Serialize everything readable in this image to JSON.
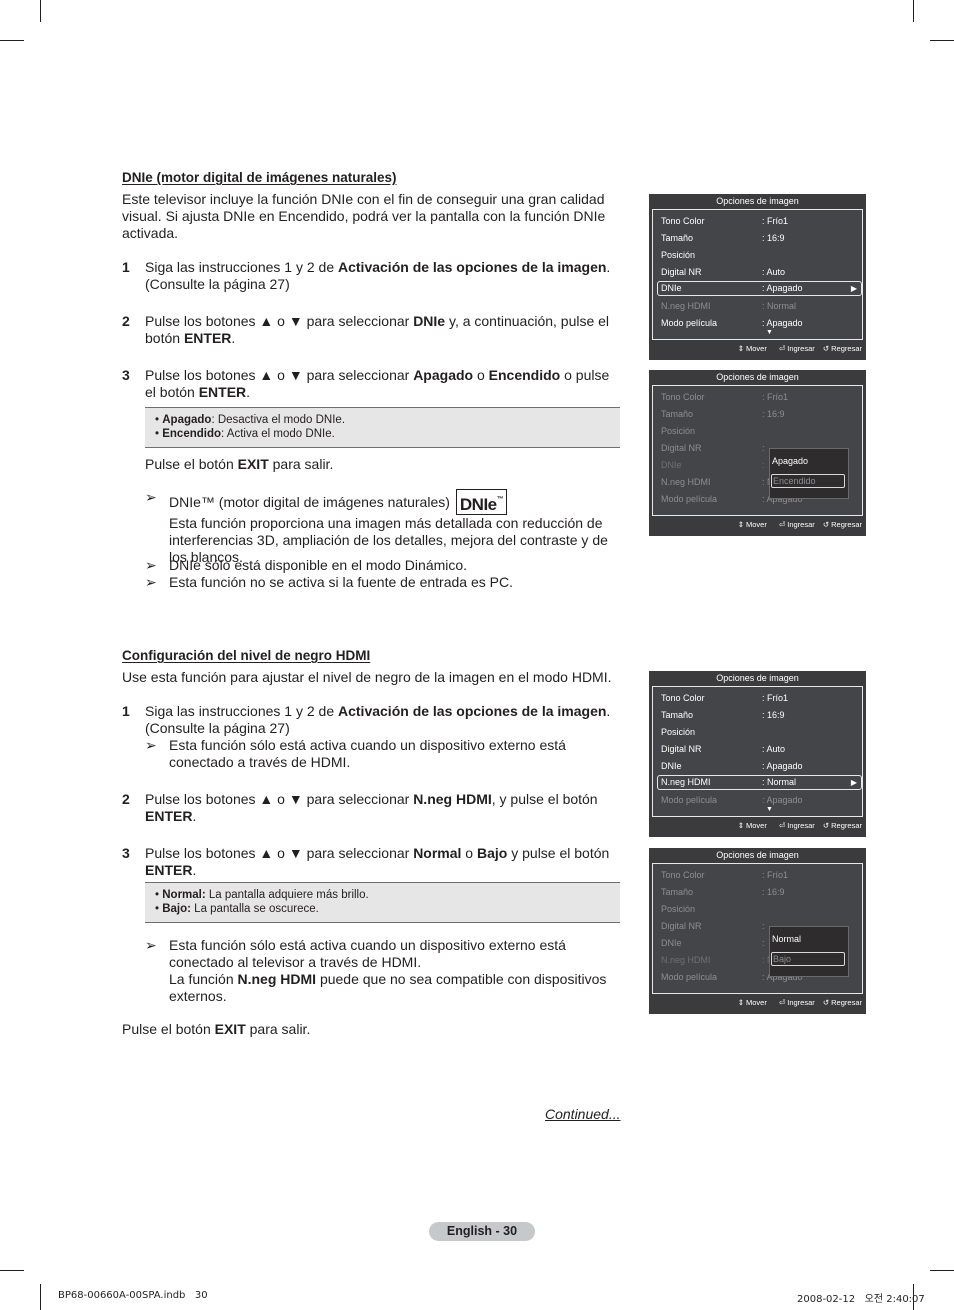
{
  "section1": {
    "title": "DNIe (motor digital de imágenes naturales)",
    "intro": "Este televisor incluye la función DNIe con el fin de conseguir una gran calidad visual. Si ajusta DNIe en Encendido, podrá ver la pantalla con la función DNIe activada.",
    "steps": [
      {
        "num": "1",
        "pre": "Siga las instrucciones 1 y 2 de ",
        "bold": "Activación de las opciones de la imagen",
        "post": ". (Consulte la página 27)"
      },
      {
        "num": "2",
        "pre": "Pulse los botones ▲ o ▼ para seleccionar ",
        "bold": "DNIe",
        "mid": " y, a continuación, pulse el botón ",
        "bold2": "ENTER",
        "post": "."
      },
      {
        "num": "3",
        "pre": "Pulse los botones ▲ o ▼ para seleccionar ",
        "bold": "Apagado",
        "mid": " o ",
        "bold2": "Encendido",
        "mid2": " o pulse el botón ",
        "bold3": "ENTER",
        "post": "."
      }
    ],
    "box": [
      {
        "term": "Apagado",
        "desc": ": Desactiva el modo DNIe."
      },
      {
        "term": "Encendido",
        "desc": ": Activa el modo DNIe."
      }
    ],
    "exit": {
      "pre": "Pulse el botón ",
      "bold": "EXIT",
      "post": " para salir."
    },
    "notes": [
      {
        "text": "DNIe™ (motor digital de imágenes naturales)",
        "logo": "DNIe",
        "logo_tm": "™",
        "text2": "Esta función proporciona una imagen más detallada con reducción de interferencias 3D, ampliación de los detalles, mejora del contraste y de los blancos."
      },
      {
        "text": "DNIe sólo está disponible en el modo Dinámico."
      },
      {
        "text": "Esta función no se activa si la fuente de entrada es PC."
      }
    ]
  },
  "section2": {
    "title": "Configuración del nivel de negro HDMI",
    "intro": "Use esta función para ajustar el nivel de negro de la imagen en el modo HDMI.",
    "steps": [
      {
        "num": "1",
        "pre": "Siga las instrucciones 1 y 2 de ",
        "bold": "Activación de las opciones de la imagen",
        "post": ". (Consulte la página 27)",
        "note": "Esta función sólo está activa cuando un dispositivo externo está conectado a través de HDMI."
      },
      {
        "num": "2",
        "pre": "Pulse los botones ▲ o ▼ para seleccionar ",
        "bold": "N.neg HDMI",
        "mid": ", y pulse el botón ",
        "bold2": "ENTER",
        "post": "."
      },
      {
        "num": "3",
        "pre": "Pulse los botones ▲ o ▼ para seleccionar ",
        "bold": "Normal",
        "mid": " o ",
        "bold2": "Bajo",
        "mid2": " y pulse el botón ",
        "bold3": "ENTER",
        "post": "."
      }
    ],
    "box": [
      {
        "term": "Normal:",
        "desc": " La pantalla adquiere más brillo."
      },
      {
        "term": "Bajo:",
        "desc": " La pantalla se oscurece."
      }
    ],
    "note": {
      "line1": "Esta función sólo está activa cuando un dispositivo externo está conectado al televisor a través de HDMI.",
      "pre": "La función ",
      "bold": "N.neg HDMI",
      "post": " puede que no sea compatible con dispositivos externos."
    },
    "exit": {
      "pre": "Pulse el botón ",
      "bold": "EXIT",
      "post": " para salir."
    }
  },
  "osd_common": {
    "title": "Opciones de imagen",
    "footer": {
      "move_icon": "⇕",
      "move": "Mover",
      "enter_icon": "⏎",
      "enter": "Ingresar",
      "return_icon": "↺",
      "return": "Regresar"
    },
    "arrow_right": "▶",
    "arrow_down": "▼"
  },
  "osd_menus": [
    {
      "rows": [
        {
          "label": "Tono Color",
          "value": ": Frío1"
        },
        {
          "label": "Tamaño",
          "value": ": 16:9"
        },
        {
          "label": "Posición",
          "value": ""
        },
        {
          "label": "Digital NR",
          "value": ": Auto"
        },
        {
          "label": "DNIe",
          "value": ": Apagado"
        },
        {
          "label": "N.neg HDMI",
          "value": ": Normal"
        },
        {
          "label": "Modo película",
          "value": ": Apagado"
        }
      ]
    },
    {
      "rows": [
        {
          "label": "Tono Color",
          "value": ": Frío1"
        },
        {
          "label": "Tamaño",
          "value": ": 16:9"
        },
        {
          "label": "Posición",
          "value": ""
        },
        {
          "label": "Digital NR",
          "value": ":"
        },
        {
          "label": "DNIe",
          "value": ":"
        },
        {
          "label": "N.neg HDMI",
          "value": ": Normal"
        },
        {
          "label": "Modo película",
          "value": ": Apagado"
        }
      ],
      "popup": {
        "option1": "Apagado",
        "option2": "Encendido"
      }
    },
    {
      "rows": [
        {
          "label": "Tono Color",
          "value": ": Frío1"
        },
        {
          "label": "Tamaño",
          "value": ": 16:9"
        },
        {
          "label": "Posición",
          "value": ""
        },
        {
          "label": "Digital NR",
          "value": ": Auto"
        },
        {
          "label": "DNIe",
          "value": ": Apagado"
        },
        {
          "label": "N.neg HDMI",
          "value": ": Normal"
        },
        {
          "label": "Modo película",
          "value": ": Apagado"
        }
      ]
    },
    {
      "rows": [
        {
          "label": "Tono Color",
          "value": ": Frío1"
        },
        {
          "label": "Tamaño",
          "value": ": 16:9"
        },
        {
          "label": "Posición",
          "value": ""
        },
        {
          "label": "Digital NR",
          "value": ":"
        },
        {
          "label": "DNIe",
          "value": ":"
        },
        {
          "label": "N.neg HDMI",
          "value": ": Normal"
        },
        {
          "label": "Modo película",
          "value": ": Apagado"
        }
      ],
      "popup": {
        "option1": "Normal",
        "option2": "Bajo"
      }
    }
  ],
  "footer": {
    "continued": "Continued...",
    "page_label": "English - 30",
    "slug_left": "BP68-00660A-00SPA.indb   30",
    "slug_right": "2008-02-12   오전 2:40:07"
  }
}
